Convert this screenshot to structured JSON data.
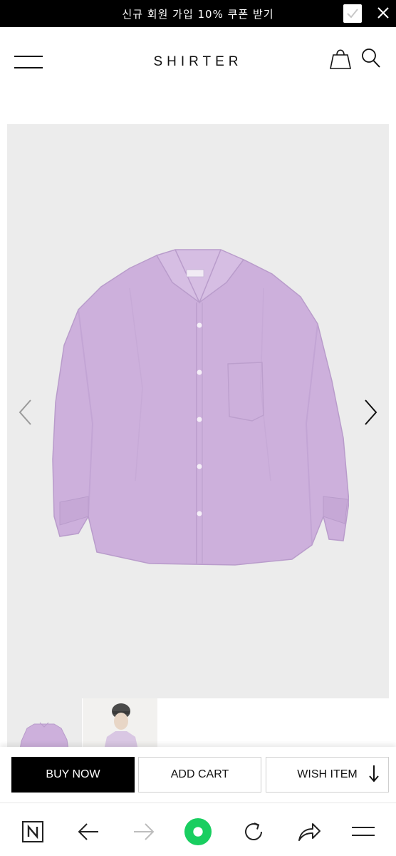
{
  "promo": {
    "text": "신규 회원 가입 10% 쿠폰 받기",
    "checkbox_checked": true,
    "close_icon": "close-icon"
  },
  "header": {
    "logo": "SHIRTER",
    "menu_icon": "hamburger-menu-icon",
    "cart_icon": "shopping-bag-icon",
    "search_icon": "search-icon"
  },
  "product": {
    "image": "lavender-oversized-shirt",
    "prev_icon": "chevron-left-icon",
    "next_icon": "chevron-right-icon",
    "thumbnails": [
      "lavender-shirt-front",
      "model-wearing-shirt"
    ]
  },
  "actions": {
    "buy_now": "BUY NOW",
    "add_cart": "ADD CART",
    "wish_item": "WISH ITEM"
  },
  "browser": {
    "items": [
      "naver-icon",
      "back-arrow-icon",
      "forward-arrow-icon",
      "home-dot-icon",
      "refresh-icon",
      "share-icon",
      "menu-icon"
    ]
  },
  "colors": {
    "accent_green": "#19ce60",
    "shirt": "#cdb0dc",
    "image_bg": "#ececec"
  }
}
